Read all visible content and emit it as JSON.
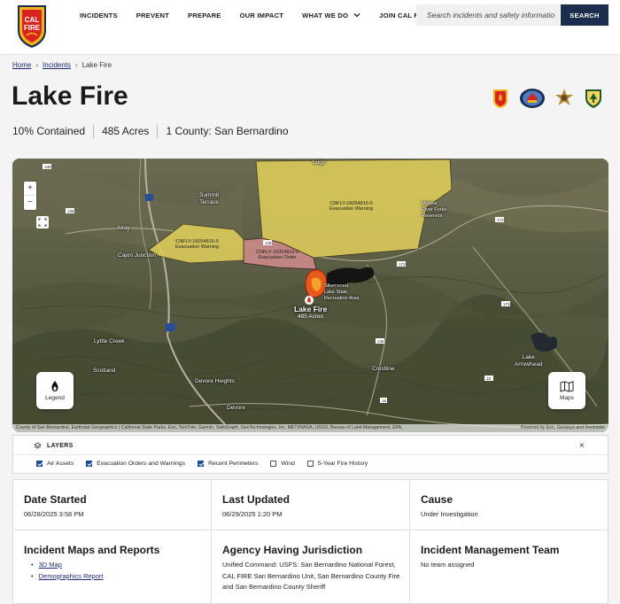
{
  "header": {
    "logo_text": "CAL FIRE",
    "nav": [
      {
        "label": "INCIDENTS"
      },
      {
        "label": "PREVENT"
      },
      {
        "label": "PREPARE"
      },
      {
        "label": "OUR IMPACT"
      },
      {
        "label": "WHAT WE DO",
        "has_dropdown": true
      },
      {
        "label": "JOIN CAL FIRE"
      }
    ],
    "search_placeholder": "Search incidents and safety informatio",
    "search_button": "SEARCH"
  },
  "breadcrumb": {
    "home": "Home",
    "incidents": "Incidents",
    "current": "Lake Fire"
  },
  "incident": {
    "title": "Lake Fire",
    "contained": "10% Contained",
    "acres": "485 Acres",
    "county": "1 County: San Bernardino",
    "agency_logos": [
      "cal-fire-seal",
      "state-seal",
      "sheriff-star",
      "usfs-shield"
    ]
  },
  "map": {
    "zoom_in": "+",
    "zoom_out": "−",
    "legend_label": "Legend",
    "maps_label": "Maps",
    "fire_name": "Lake Fire",
    "fire_acres": "485 Acres",
    "places": {
      "lugo": "Lugo",
      "summit_terrace": "Summit\nTerrace",
      "alray": "Alray",
      "cajon_junction": "Cajon Junction",
      "lyttle_creek": "Lyttle Creek",
      "scotland": "Scotland",
      "devore_heights": "Devore Heights",
      "devore": "Devore",
      "crestline": "Crestline",
      "lake_arrowhead": "Lake\nArrowhead",
      "silverwood": "Silverwood\nLake State\nRecreation Area",
      "mojave": "Mojave\nRiver Forks\nReservoir"
    },
    "zones": {
      "zone1_id": "CNFLY-16054816-0",
      "zone1_type": "Evacuation Warning",
      "zone2_id": "CNFLY-16054816-0",
      "zone2_type": "Evacuation Warning",
      "zone3_id": "CNFLY-16054816-0",
      "zone3_type": "Evacuation Order"
    },
    "routes": [
      "138",
      "15",
      "173",
      "173",
      "138",
      "18",
      "15",
      "138",
      "173"
    ],
    "attribution": "County of San Bernardino, Earthstar Geographics | California State Parks, Esri, TomTom, Garmin, SafeGraph, GeoTechnologies, Inc, METI/NASA, USGS, Bureau of Land Management, EPA,",
    "powered_by": "Powered by Esri, Genasys and Perimeter",
    "colors": {
      "warning": "#d8c85a",
      "order": "#c98a88",
      "fire": "#e85a1c"
    }
  },
  "layers": {
    "title": "LAYERS",
    "close": "×",
    "options": [
      {
        "label": "Air Assets",
        "checked": true
      },
      {
        "label": "Evacuation Orders and Warnings",
        "checked": true
      },
      {
        "label": "Recent Perimeters",
        "checked": true
      },
      {
        "label": "Wind",
        "checked": false
      },
      {
        "label": "5-Year Fire History",
        "checked": false
      }
    ]
  },
  "details": {
    "date_started_label": "Date Started",
    "date_started": "06/28/2025 3:58 PM",
    "last_updated_label": "Last Updated",
    "last_updated": "06/29/2025 1:20 PM",
    "cause_label": "Cause",
    "cause": "Under Investigation",
    "maps_reports_label": "Incident Maps and Reports",
    "reports": [
      "3D Map",
      "Demographics Report"
    ],
    "jurisdiction_label": "Agency Having Jurisdiction",
    "jurisdiction": "Unified Command: USFS: San Bernardino National Forest, CAL FIRE San Bernardino Unit, San Bernardino County Fire and San Bernardino County Sheriff",
    "team_label": "Incident Management Team",
    "team": "No team assigned"
  }
}
